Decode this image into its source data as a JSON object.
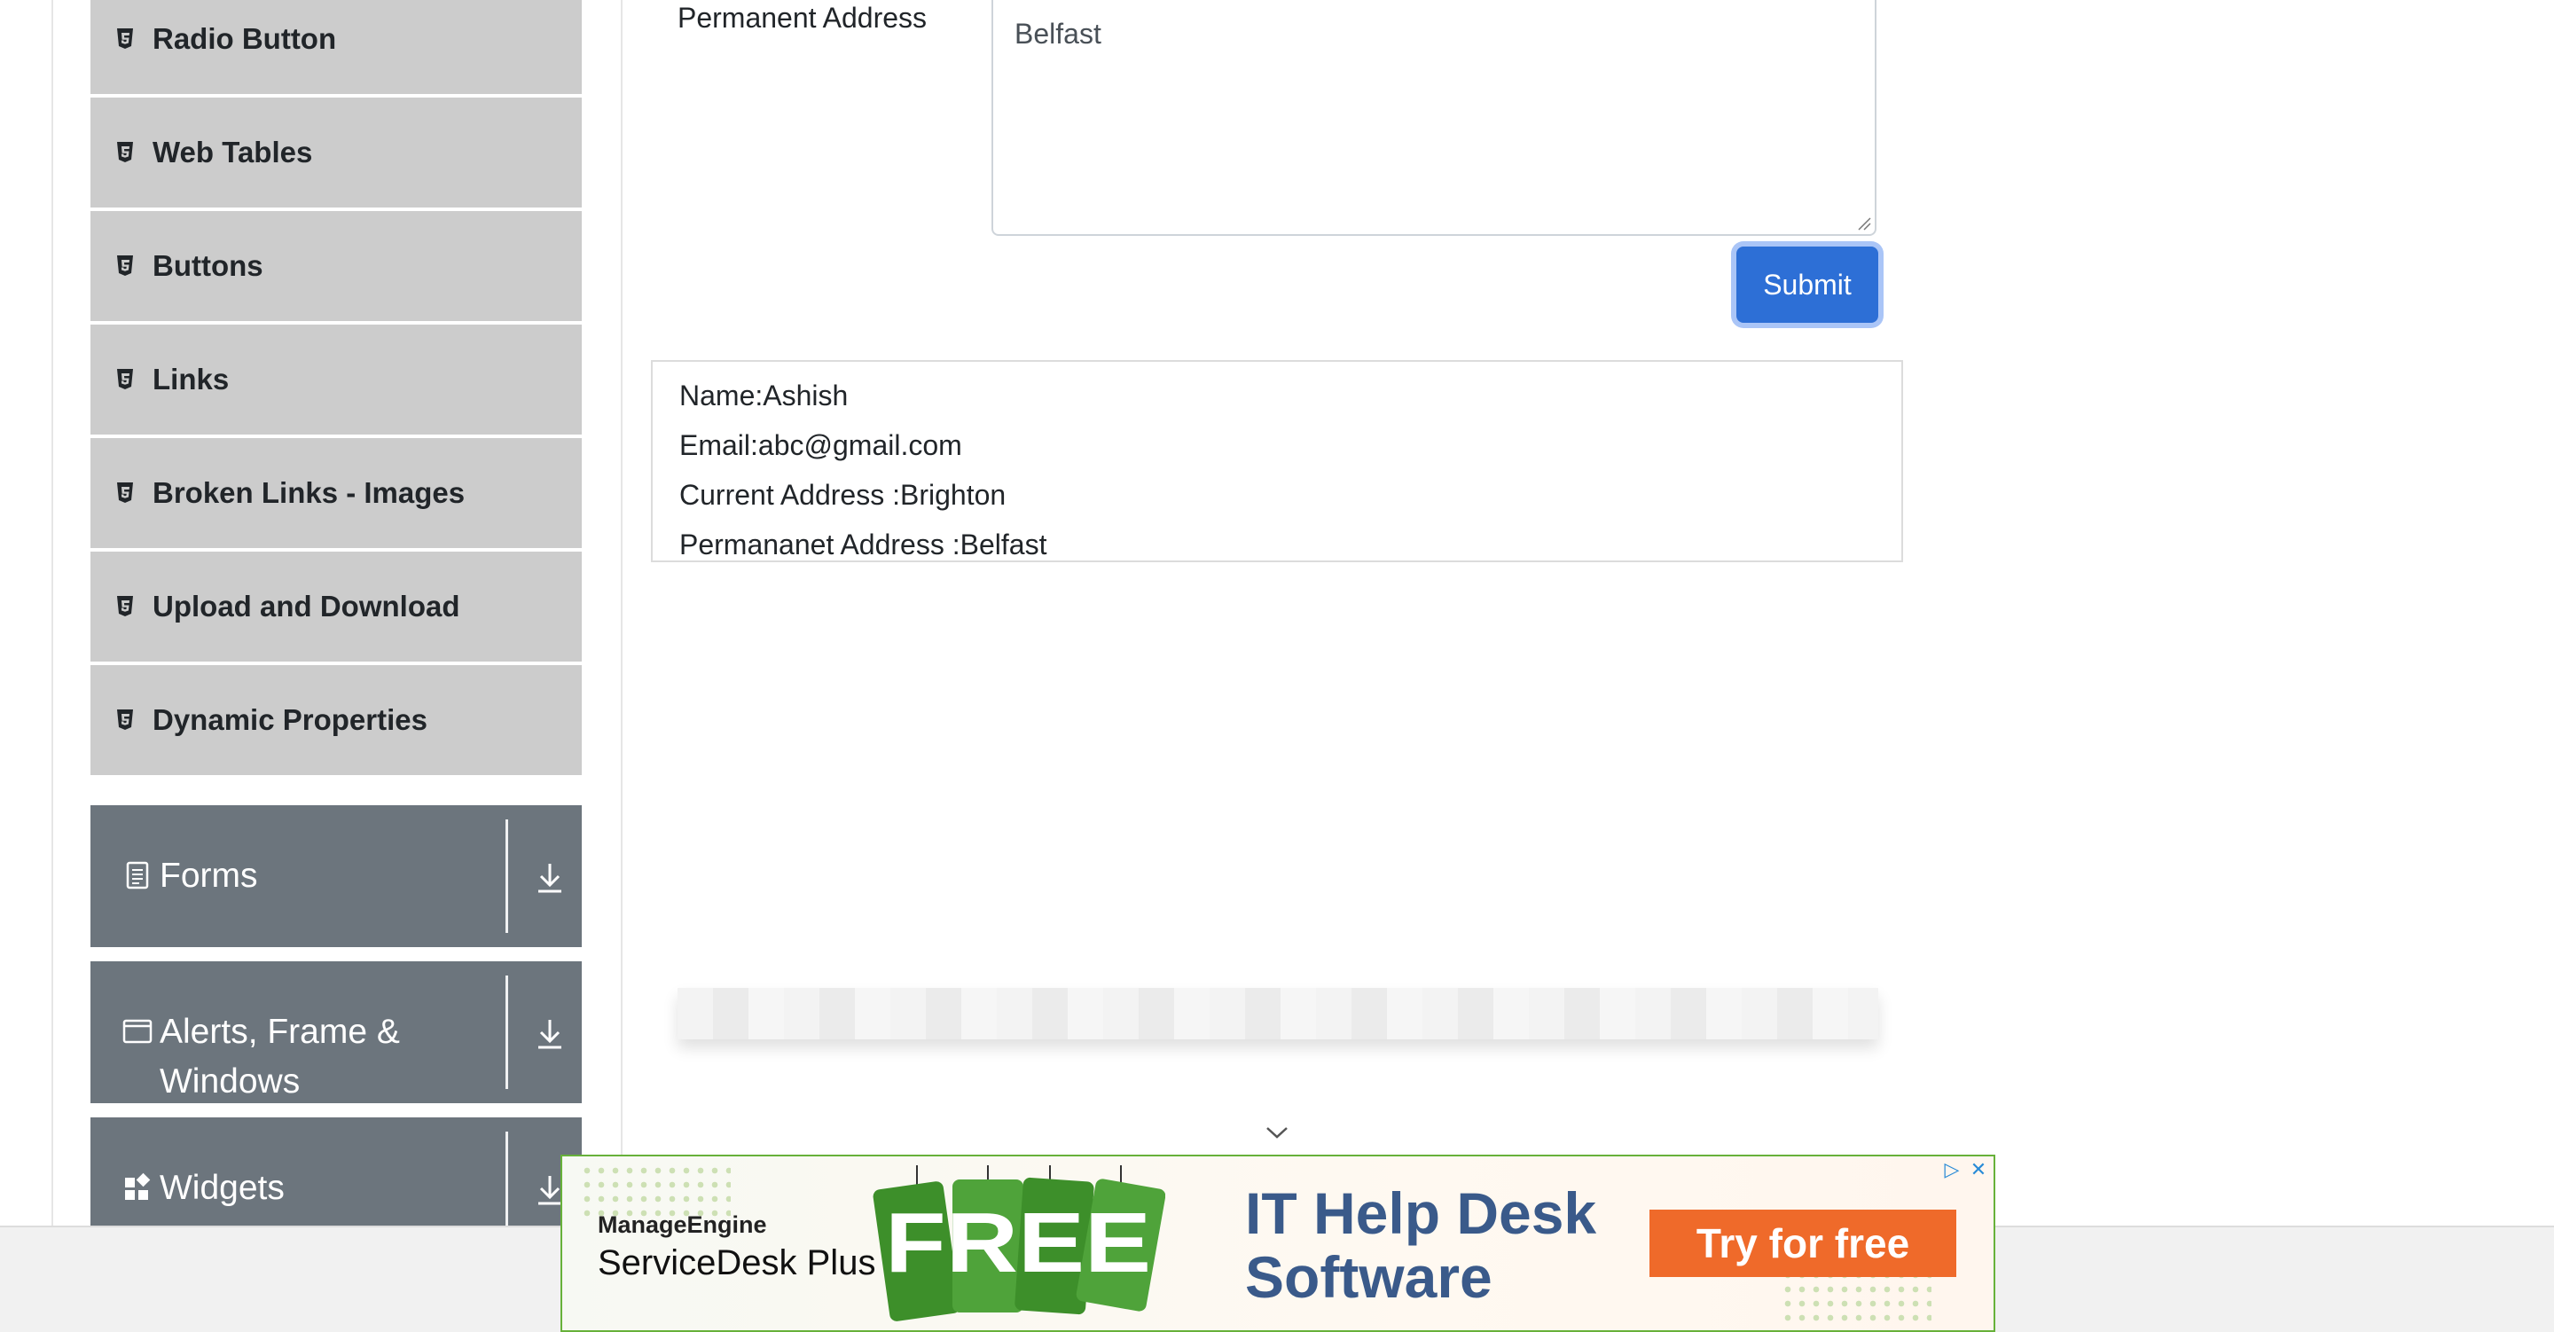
{
  "sidebar": {
    "items": [
      {
        "label": "Radio Button"
      },
      {
        "label": "Web Tables"
      },
      {
        "label": "Buttons"
      },
      {
        "label": "Links"
      },
      {
        "label": "Broken Links - Images"
      },
      {
        "label": "Upload and Download"
      },
      {
        "label": "Dynamic Properties"
      }
    ],
    "groups": [
      {
        "label": "Forms",
        "icon": "document-icon"
      },
      {
        "label_line1": "Alerts, Frame &",
        "label_line2": "Windows",
        "icon": "window-icon"
      },
      {
        "label": "Widgets",
        "icon": "widgets-icon"
      }
    ]
  },
  "form": {
    "permanent_address_label": "Permanent Address",
    "permanent_address_value": "Belfast",
    "submit_label": "Submit"
  },
  "output": {
    "name": "Name:Ashish",
    "email": "Email:abc@gmail.com",
    "current_address": "Current Address :Brighton",
    "permanent_address": "Permananet Address :Belfast"
  },
  "ad": {
    "brand_small": "ManageEngine",
    "brand_big": "ServiceDesk Plus",
    "free_text": "FREE",
    "headline_line1": "IT Help Desk",
    "headline_line2": "Software",
    "cta": "Try for free"
  },
  "colors": {
    "sidebar_item_bg": "#cccccc",
    "group_bg": "#6c757d",
    "submit_bg": "#2d6fd6",
    "ad_cta": "#ef6a2a",
    "ad_border": "#67b13a"
  }
}
